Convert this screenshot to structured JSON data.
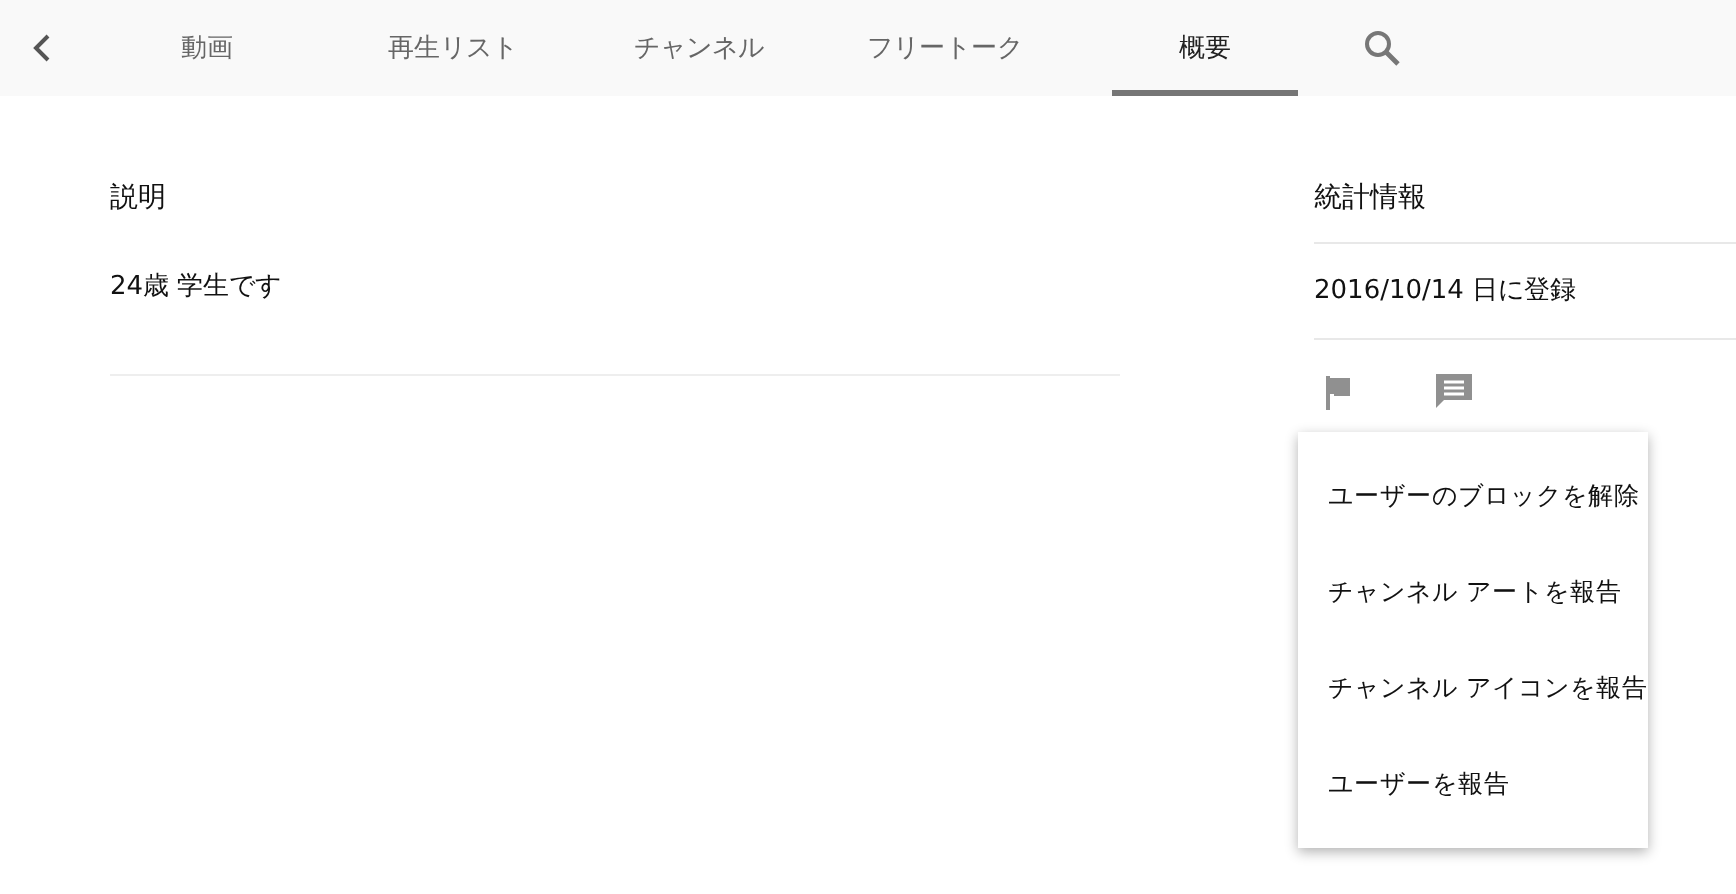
{
  "tabs": [
    {
      "label": "動画",
      "selected": false
    },
    {
      "label": "再生リスト",
      "selected": false
    },
    {
      "label": "チャンネル",
      "selected": false
    },
    {
      "label": "フリートーク",
      "selected": false
    },
    {
      "label": "概要",
      "selected": true
    }
  ],
  "description": {
    "heading": "説明",
    "text": "24歳 学生です"
  },
  "stats": {
    "heading": "統計情報",
    "joined": "2016/10/14 日に登録"
  },
  "menu": {
    "items": [
      "ユーザーのブロックを解除",
      "チャンネル アートを報告",
      "チャンネル アイコンを報告",
      "ユーザーを報告"
    ]
  }
}
